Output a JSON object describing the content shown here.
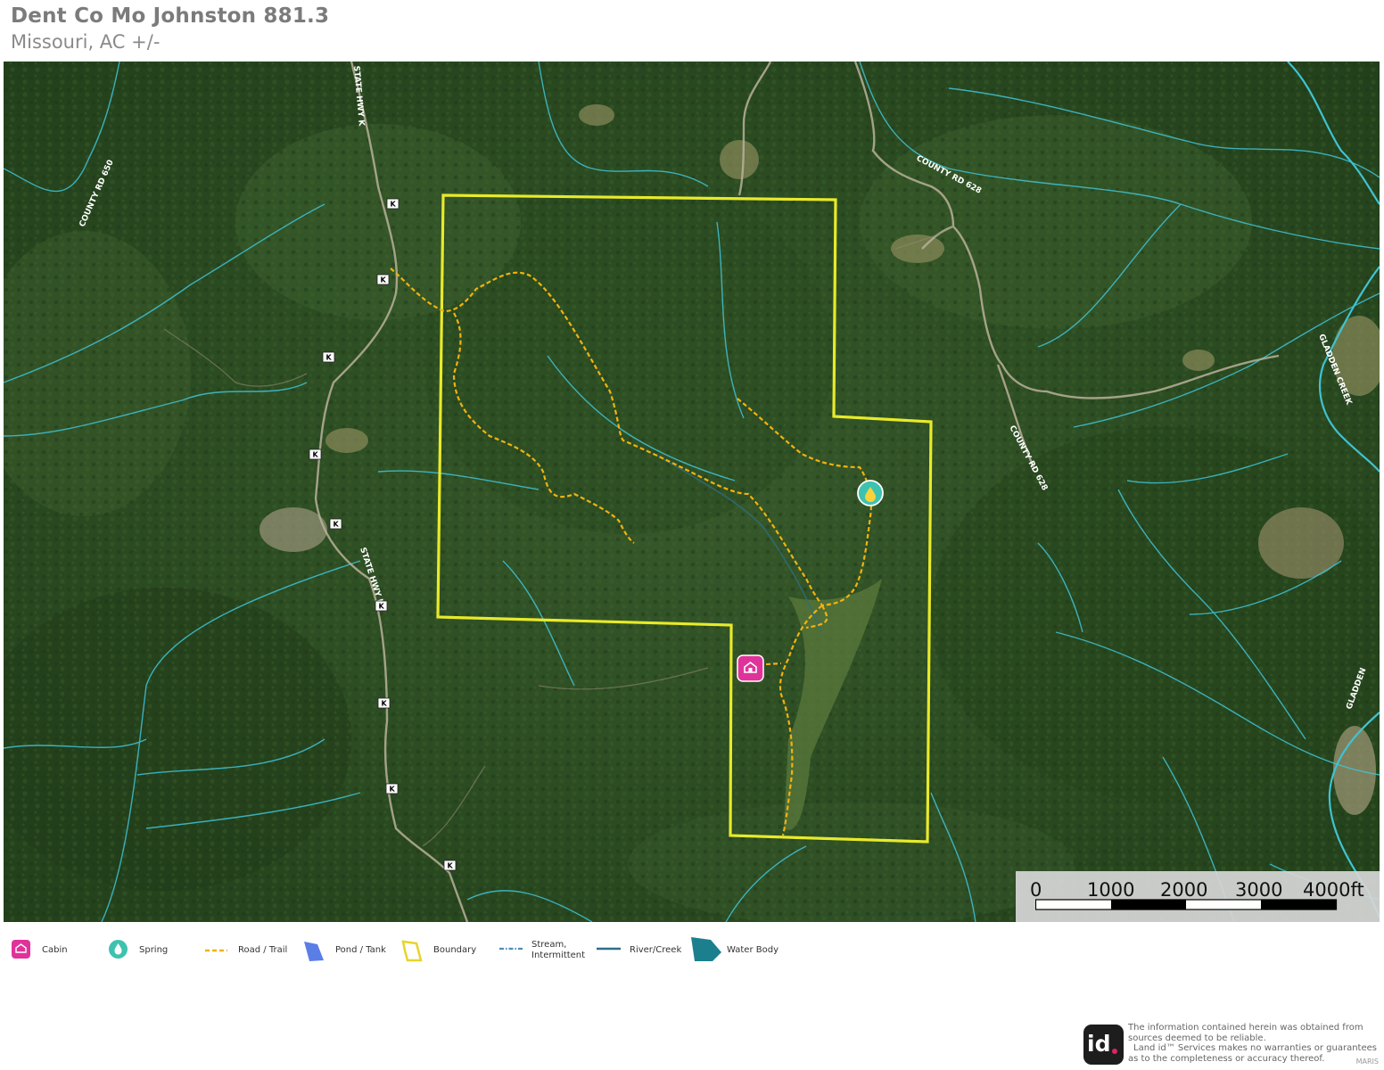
{
  "header": {
    "title": "Dent Co Mo Johnston 881.3",
    "subtitle": "Missouri,  AC +/-"
  },
  "map": {
    "road_labels": {
      "county_rd_650": "COUNTY RD 650",
      "state_hwy_k_north": "STATE HWY K",
      "state_hwy_k_south": "STATE HWY K",
      "county_rd_628_north": "COUNTY RD 628",
      "county_rd_628_south": "COUNTY RD 628",
      "gladden_creek": "GLADDEN CREEK",
      "gladden_edge": "GLADDEN"
    },
    "highway_shield": "K",
    "colors": {
      "boundary": "#e8ea2a",
      "trail": "#f2b20e",
      "stream": "#40c4d8",
      "cabin": "#e0339a",
      "spring": "#3ec2b0",
      "forest": "#2c4d22"
    }
  },
  "scale": {
    "ticks": [
      "0",
      "1000",
      "2000",
      "3000",
      "4000ft"
    ]
  },
  "legend": {
    "cabin": "Cabin",
    "spring": "Spring",
    "road_trail": "Road / Trail",
    "pond_tank": "Pond / Tank",
    "boundary": "Boundary",
    "stream_line1": "Stream,",
    "stream_line2": "Intermittent",
    "river_creek": "River/Creek",
    "water_body": "Water Body"
  },
  "footer": {
    "logo": "id",
    "disclaimer_1": "The information contained herein was obtained from",
    "disclaimer_2": "sources deemed to be reliable.",
    "disclaimer_3": "Land id™ Services makes no warranties or guarantees",
    "disclaimer_4": "as to the completeness or accuracy thereof.",
    "source": "MARIS"
  }
}
